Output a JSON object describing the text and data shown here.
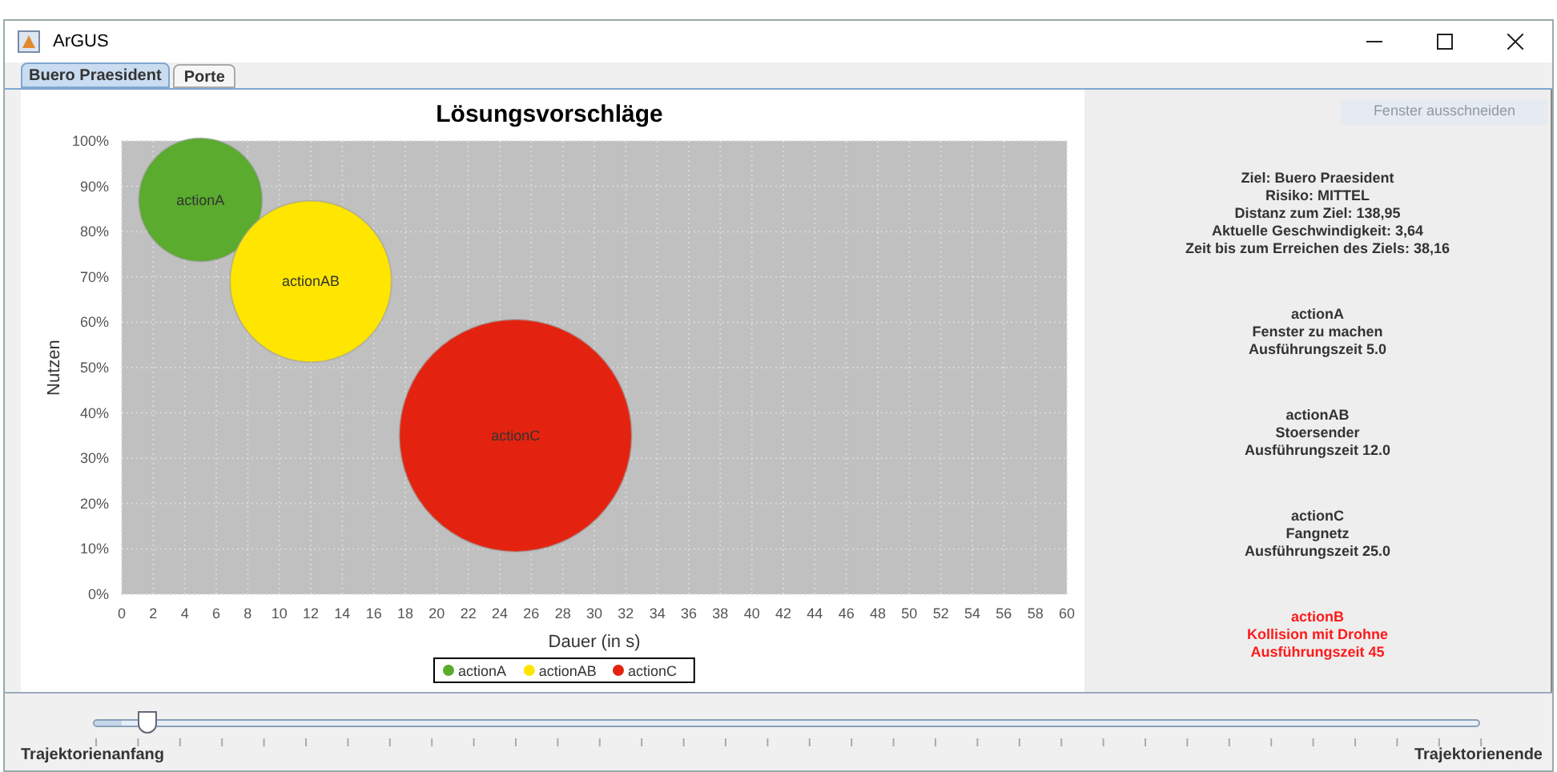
{
  "window": {
    "title": "ArGUS"
  },
  "tabs": [
    {
      "label": "Buero Praesident",
      "selected": true
    },
    {
      "label": "Porte",
      "selected": false
    }
  ],
  "chart": {
    "chart_data": {
      "type": "scatter",
      "title": "Lösungsvorschläge",
      "xlabel": "Dauer (in s)",
      "ylabel": "Nutzen",
      "xlim": [
        0,
        60
      ],
      "ylim": [
        0,
        100
      ],
      "xticks": [
        0,
        2,
        4,
        6,
        8,
        10,
        12,
        14,
        16,
        18,
        20,
        22,
        24,
        26,
        28,
        30,
        32,
        34,
        36,
        38,
        40,
        42,
        44,
        46,
        48,
        50,
        52,
        54,
        56,
        58,
        60
      ],
      "yticks": [
        {
          "value": 0,
          "label": "0%"
        },
        {
          "value": 10,
          "label": "10%"
        },
        {
          "value": 20,
          "label": "20%"
        },
        {
          "value": 30,
          "label": "30%"
        },
        {
          "value": 40,
          "label": "40%"
        },
        {
          "value": 50,
          "label": "50%"
        },
        {
          "value": 60,
          "label": "60%"
        },
        {
          "value": 70,
          "label": "70%"
        },
        {
          "value": 80,
          "label": "80%"
        },
        {
          "value": 90,
          "label": "90%"
        },
        {
          "value": 100,
          "label": "100%"
        }
      ],
      "x": [
        5,
        12,
        25
      ],
      "series": [
        {
          "name": "actionA",
          "color": "#5aab2e",
          "values": [
            87,
            null,
            null
          ],
          "value_labels": [
            "actionA",
            null,
            null
          ]
        },
        {
          "name": "actionAB",
          "color": "#ffe600",
          "values": [
            null,
            69,
            null
          ],
          "value_labels": [
            null,
            "actionAB",
            null
          ]
        },
        {
          "name": "actionC",
          "color": "#e3230f",
          "values": [
            null,
            null,
            35
          ],
          "value_labels": [
            null,
            null,
            "actionC"
          ]
        }
      ],
      "grid": true,
      "legend": "bottom"
    }
  },
  "side_panel": {
    "button": {
      "label": "Fenster ausschneiden",
      "disabled": true
    },
    "blocks": [
      {
        "lines": [
          "Ziel: Buero Praesident",
          "Risiko: MITTEL",
          "Distanz zum Ziel: 138,95",
          "Aktuelle Geschwindigkeit: 3,64",
          "Zeit bis zum Erreichen des Ziels: 38,16"
        ],
        "color": "#333333"
      },
      {
        "lines": [
          "actionA",
          "Fenster zu machen",
          "Ausführungszeit 5.0"
        ],
        "color": "#333333"
      },
      {
        "lines": [
          "actionAB",
          "Stoersender",
          "Ausführungszeit 12.0"
        ],
        "color": "#333333"
      },
      {
        "lines": [
          "actionC",
          "Fangnetz",
          "Ausführungszeit 25.0"
        ],
        "color": "#333333"
      },
      {
        "lines": [
          "actionB",
          "Kollision mit Drohne",
          "Ausführungszeit 45"
        ],
        "color": "#ff1a1a"
      }
    ]
  },
  "slider": {
    "level": 0.02,
    "start_label": "Trajektorienanfang",
    "end_label": "Trajektorienende"
  }
}
